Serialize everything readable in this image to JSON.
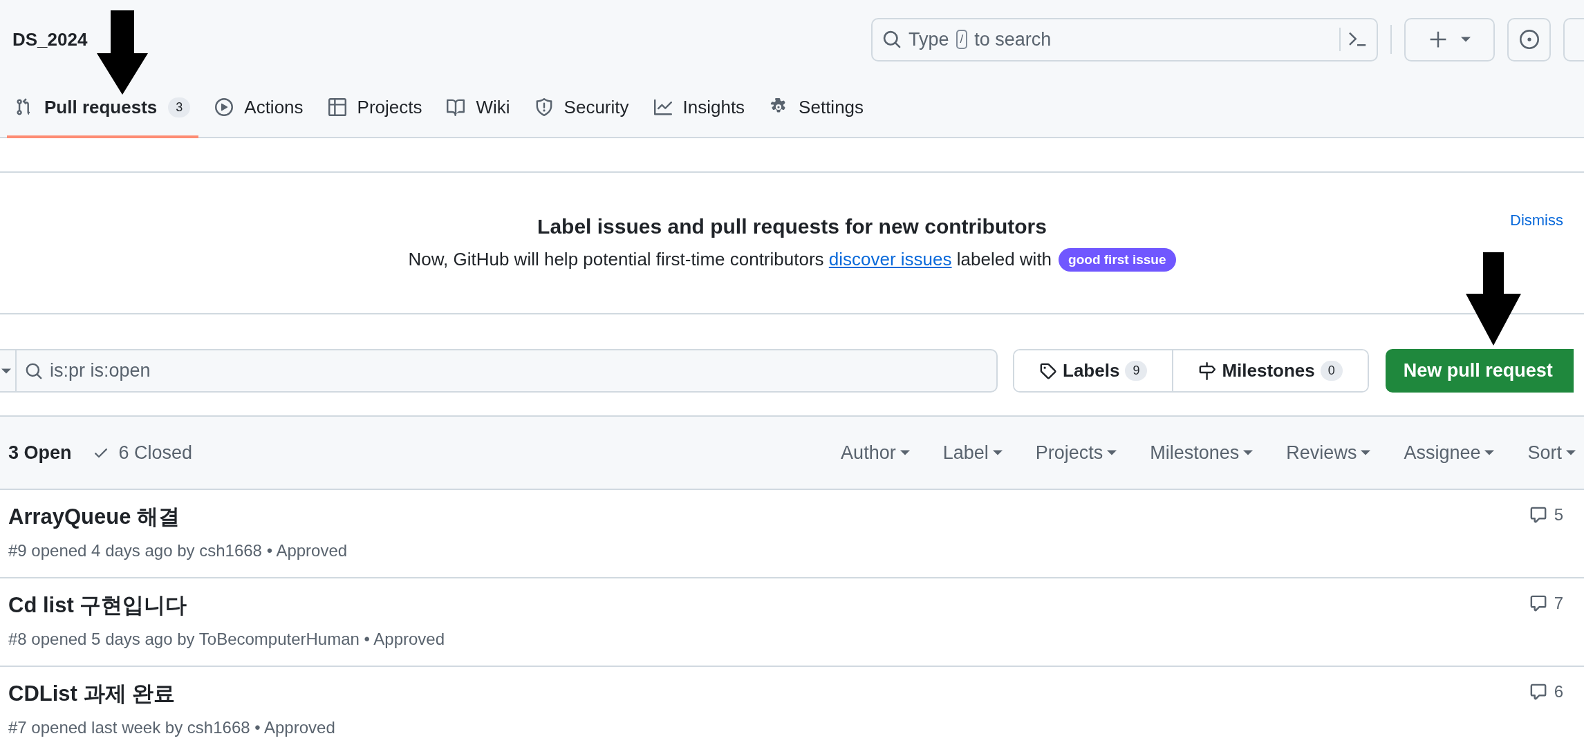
{
  "repo": {
    "name": "DS_2024"
  },
  "search": {
    "before_key": "Type",
    "key": "/",
    "after_key": "to search"
  },
  "tabs": [
    {
      "label": "Pull requests",
      "count": "3",
      "selected": true
    },
    {
      "label": "Actions",
      "selected": false
    },
    {
      "label": "Projects",
      "selected": false
    },
    {
      "label": "Wiki",
      "selected": false
    },
    {
      "label": "Security",
      "selected": false
    },
    {
      "label": "Insights",
      "selected": false
    },
    {
      "label": "Settings",
      "selected": false
    }
  ],
  "banner": {
    "title": "Label issues and pull requests for new contributors",
    "text_before": "Now, GitHub will help potential first-time contributors",
    "link": "discover issues",
    "text_after": "labeled with",
    "label": {
      "text": "good first issue",
      "color": "#7057ff"
    },
    "dismiss": "Dismiss"
  },
  "filter": {
    "value": "is:pr is:open"
  },
  "labels_button": {
    "label": "Labels",
    "count": "9"
  },
  "milestones_button": {
    "label": "Milestones",
    "count": "0"
  },
  "new_button": "New pull request",
  "states": [
    {
      "label": "3 Open",
      "selected": true
    },
    {
      "label": "6 Closed",
      "selected": false
    }
  ],
  "filters": [
    "Author",
    "Label",
    "Projects",
    "Milestones",
    "Reviews",
    "Assignee",
    "Sort"
  ],
  "pull_requests": [
    {
      "title": "ArrayQueue 해결",
      "meta": "#9 opened 4 days ago by csh1668 • Approved",
      "comments": "5"
    },
    {
      "title": "Cd list 구현입니다",
      "meta": "#8 opened 5 days ago by ToBecomputerHuman • Approved",
      "comments": "7"
    },
    {
      "title": "CDList 과제 완료",
      "meta": "#7 opened last week by csh1668 • Approved",
      "comments": "6"
    }
  ]
}
